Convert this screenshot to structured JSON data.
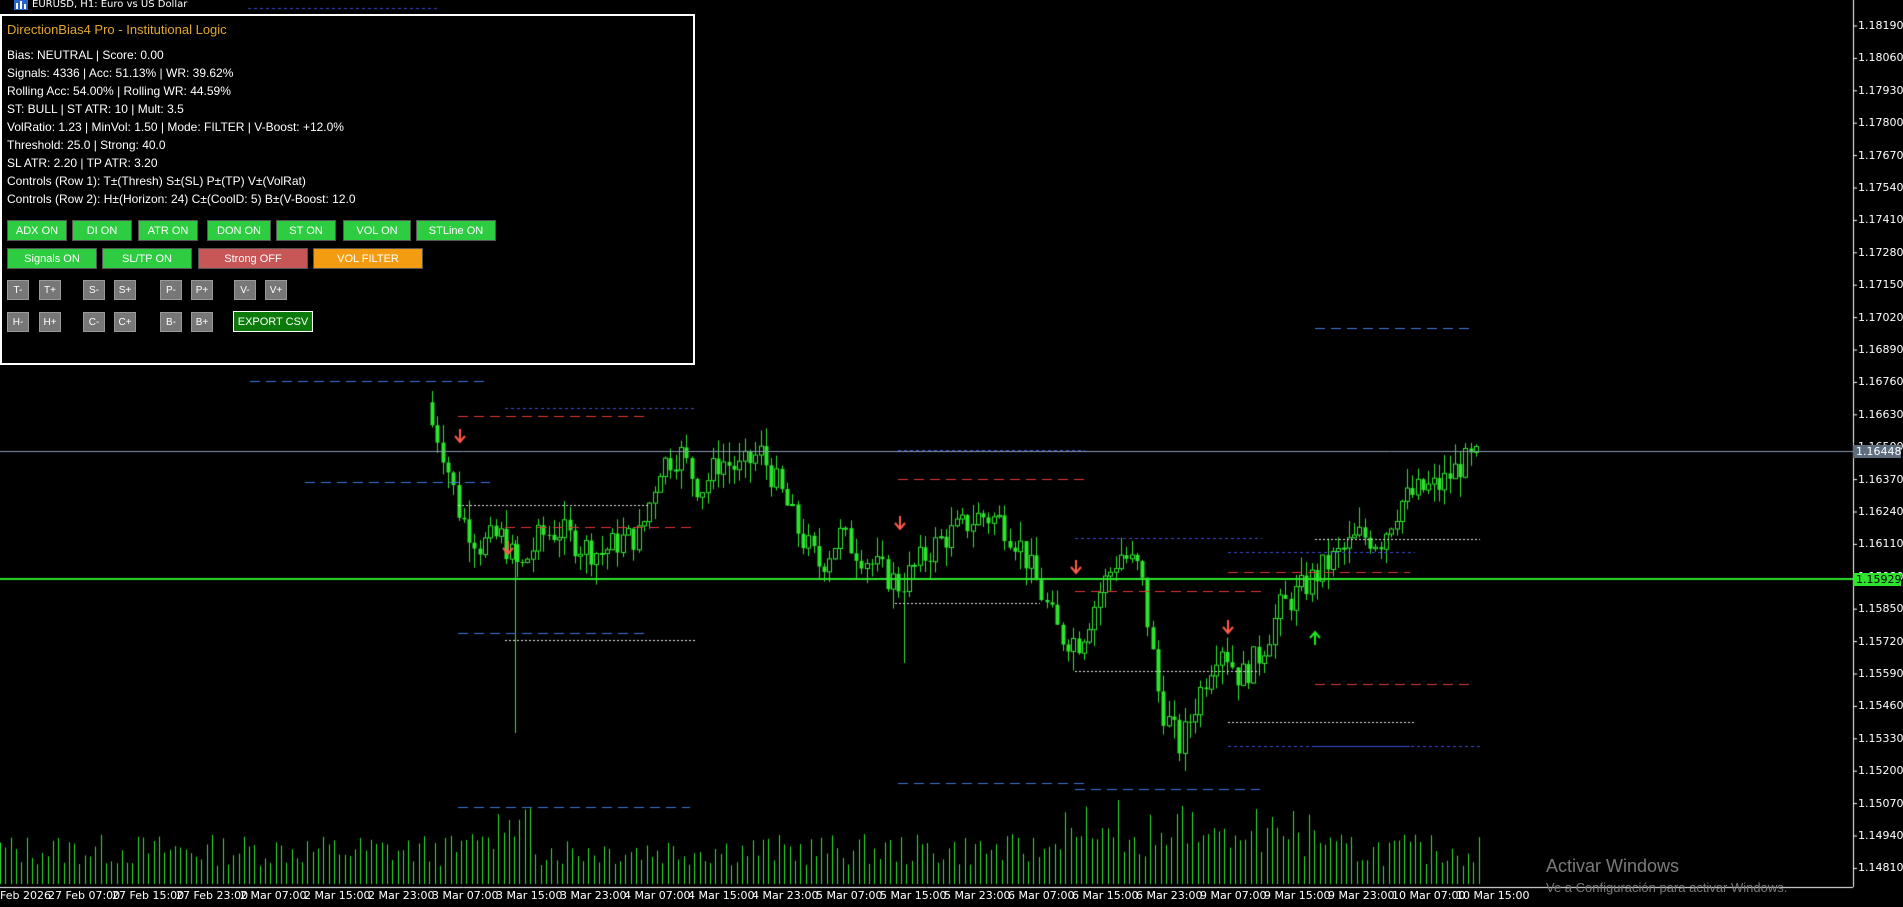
{
  "window": {
    "symbol_title": "EURUSD, H1:  Euro vs US Dollar"
  },
  "panel": {
    "title": "DirectionBias4 Pro - Institutional Logic",
    "lines": [
      "Bias: NEUTRAL | Score: 0.00",
      "Signals: 4336 | Acc: 51.13% | WR: 39.62%",
      "Rolling Acc: 54.00% | Rolling WR: 44.59%",
      "ST: BULL | ST ATR: 10 | Mult: 3.5",
      "VolRatio: 1.23 | MinVol: 1.50 | Mode: FILTER | V-Boost: +12.0%",
      "Threshold: 25.0 | Strong: 40.0",
      "SL ATR: 2.20 | TP ATR: 3.20",
      "Controls (Row 1): T±(Thresh) S±(SL) P±(TP) V±(VolRat)",
      "Controls (Row 2): H±(Horizon: 24) C±(CoolD: 5) B±(V-Boost: 12.0"
    ],
    "toggle_row1": [
      "ADX ON",
      "DI ON",
      "ATR ON",
      "DON ON",
      "ST ON",
      "VOL ON",
      "STLine ON"
    ],
    "toggle_row2": [
      "Signals ON",
      "SL/TP ON",
      "Strong OFF",
      "VOL FILTER"
    ],
    "step_row1": [
      "T-",
      "T+",
      "S-",
      "S+",
      "P-",
      "P+",
      "V-",
      "V+"
    ],
    "step_row2": [
      "H-",
      "H+",
      "C-",
      "C+",
      "B-",
      "B+"
    ],
    "export_label": "EXPORT CSV"
  },
  "price_axis": {
    "labels": [
      "1.18190",
      "1.18060",
      "1.17930",
      "1.17800",
      "1.17670",
      "1.17540",
      "1.17410",
      "1.17280",
      "1.17150",
      "1.17020",
      "1.16890",
      "1.16760",
      "1.16630",
      "1.16500",
      "1.16370",
      "1.16240",
      "1.16110",
      "1.15980",
      "1.15850",
      "1.15720",
      "1.15590",
      "1.15460",
      "1.15330",
      "1.15200",
      "1.15070",
      "1.14940",
      "1.14810"
    ],
    "bid_tag": "1.16448",
    "line_tag": "1.15929"
  },
  "time_axis": {
    "labels": [
      "Feb 2026",
      "27 Feb 07:00",
      "27 Feb 15:00",
      "27 Feb 23:00",
      "2 Mar 07:00",
      "2 Mar 15:00",
      "2 Mar 23:00",
      "3 Mar 07:00",
      "3 Mar 15:00",
      "3 Mar 23:00",
      "4 Mar 07:00",
      "4 Mar 15:00",
      "4 Mar 23:00",
      "5 Mar 07:00",
      "5 Mar 15:00",
      "5 Mar 23:00",
      "6 Mar 07:00",
      "6 Mar 15:00",
      "6 Mar 23:00",
      "9 Mar 07:00",
      "9 Mar 15:00",
      "9 Mar 23:00",
      "10 Mar 07:00",
      "10 Mar 15:00"
    ]
  },
  "watermark": {
    "line1": "Activar Windows",
    "line2": "Ve a Configuración para activar Windows."
  },
  "colors": {
    "candle": "#2ee52e",
    "bid_line": "#8a9ab0",
    "green_line": "#2ee52e",
    "sl_red": "#e03a3a",
    "tp_blue": "#3a7ae0",
    "sell_arrow": "#ff5a4a",
    "buy_arrow": "#1ee81e",
    "panel_title": "#e3a72f"
  },
  "chart_data": {
    "type": "candlestick",
    "symbol": "EURUSD",
    "timeframe": "H1",
    "last_price": 1.16448,
    "horizontal_line": 1.15929,
    "price_range": [
      1.1475,
      1.1825
    ],
    "sell_signals": 5,
    "buy_signals": 1
  }
}
